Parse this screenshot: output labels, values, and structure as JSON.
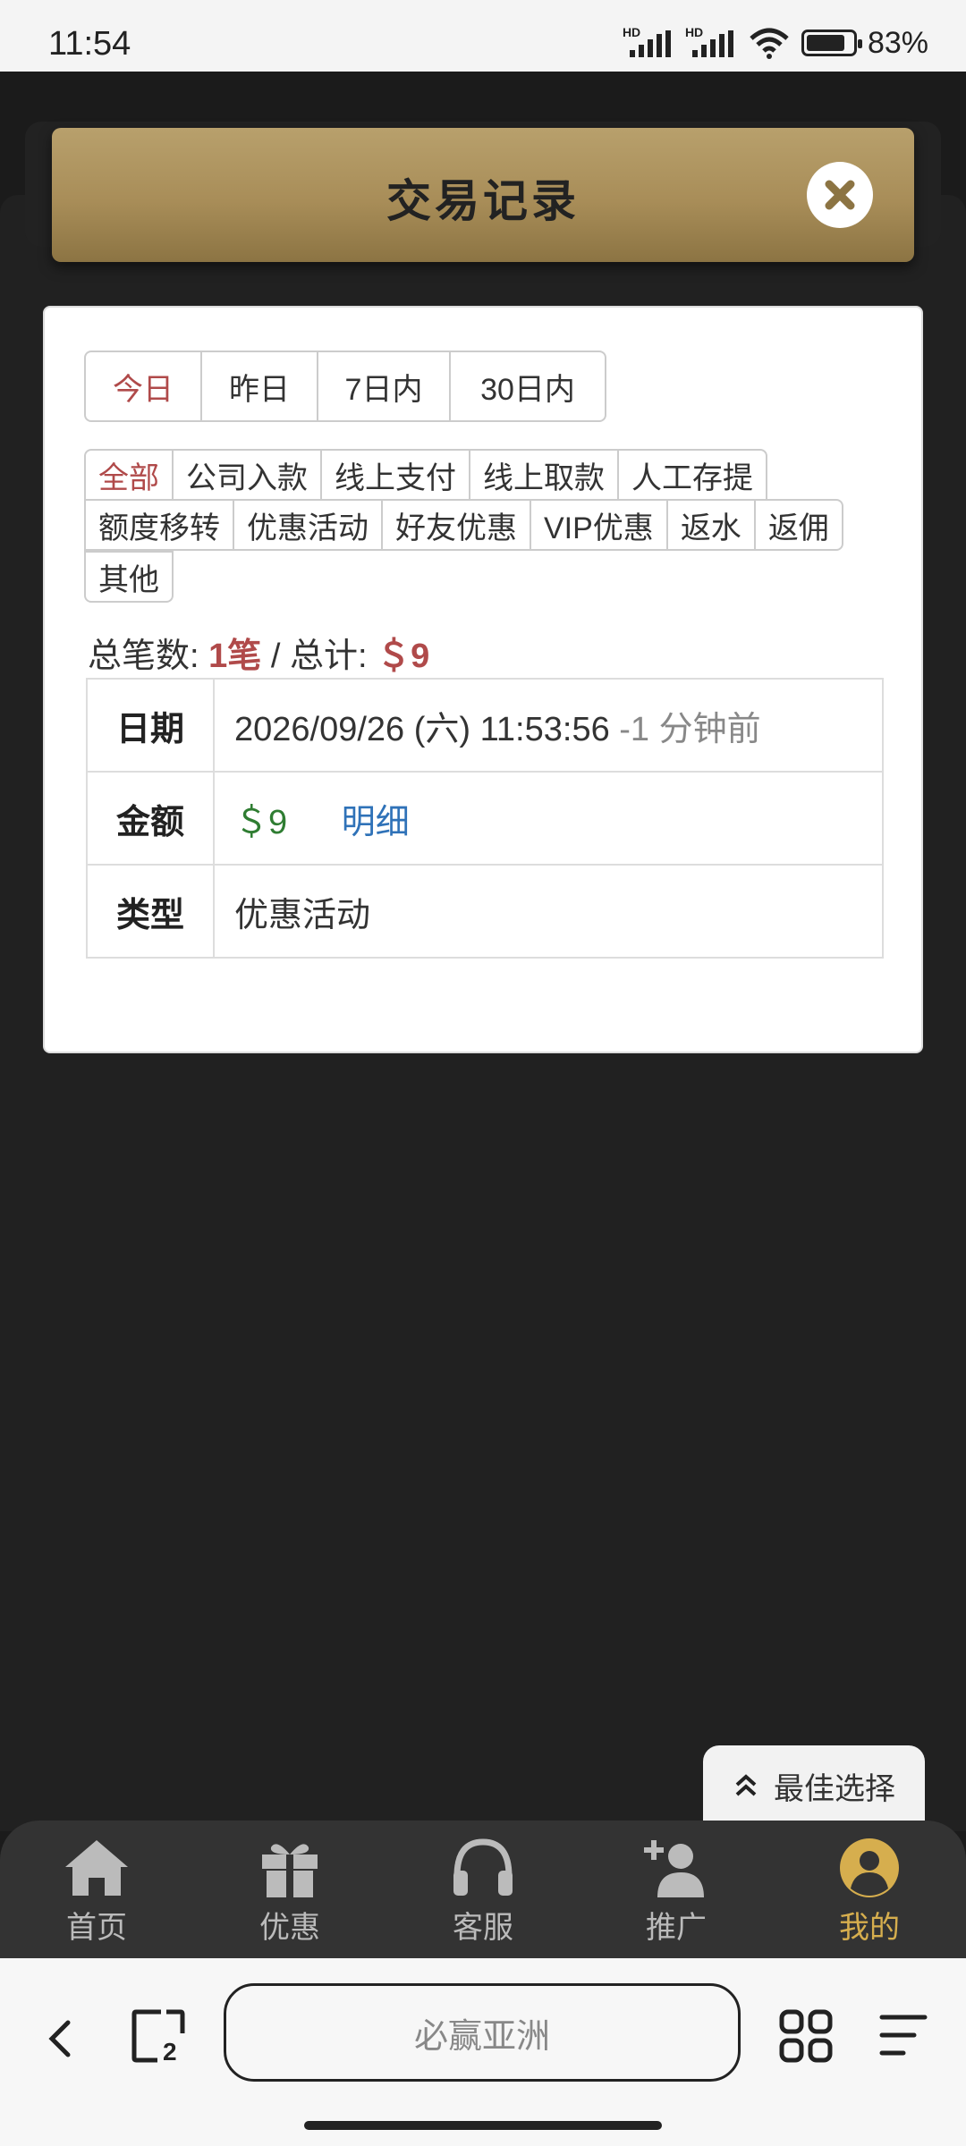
{
  "status_bar": {
    "time": "11:54",
    "battery": "83%",
    "battery_level": 0.83
  },
  "modal": {
    "title": "交易记录",
    "tabs": [
      "今日",
      "昨日",
      "7日内",
      "30日内"
    ],
    "active_tab": "今日",
    "filters_row1": [
      "全部",
      "公司入款",
      "线上支付",
      "线上取款",
      "人工存提"
    ],
    "filters_row2": [
      "额度移转",
      "优惠活动",
      "好友优惠",
      "VIP优惠",
      "返水",
      "返佣"
    ],
    "filters_row3": [
      "其他"
    ],
    "active_filter": "全部",
    "summary": {
      "count_label": "总笔数:",
      "count": "1笔",
      "sep": " / ",
      "total_label": "总计:",
      "total": "＄9"
    },
    "record": {
      "date_label": "日期",
      "date": "2026/09/26 (六) 11:53:56",
      "date_ago": "-1 分钟前",
      "amount_label": "金额",
      "amount": "＄9",
      "detail_link": "明细",
      "type_label": "类型",
      "type": "优惠活动"
    }
  },
  "floating_button": {
    "label": "最佳选择"
  },
  "nav": [
    {
      "label": "首页",
      "icon": "home-icon"
    },
    {
      "label": "优惠",
      "icon": "gift-icon"
    },
    {
      "label": "客服",
      "icon": "headset-icon"
    },
    {
      "label": "推广",
      "icon": "add-user-icon"
    },
    {
      "label": "我的",
      "icon": "user-icon",
      "active": true
    }
  ],
  "browser": {
    "address": "必赢亚洲",
    "tab_count": "2"
  },
  "colors": {
    "accent_gold": "#d6ae4e",
    "active_red": "#b04a4a",
    "amount_green": "#2f7d32",
    "link_blue": "#2f72b8"
  }
}
